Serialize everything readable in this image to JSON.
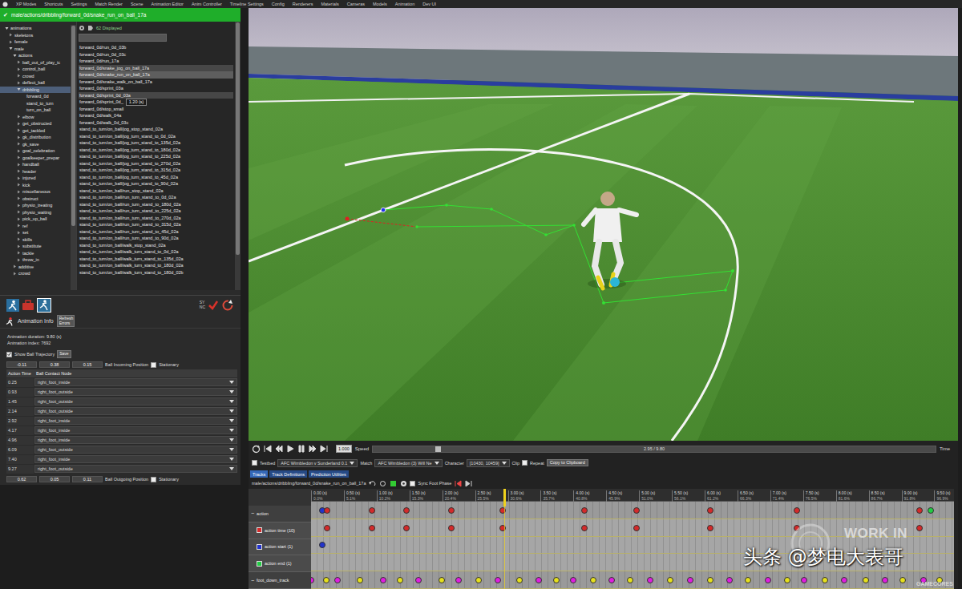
{
  "menu_bar": {
    "items": [
      "XP Modes",
      "Shortcuts",
      "Settings",
      "Match Render",
      "Scene",
      "Animation Editor",
      "Anim Controller",
      "Timeline Settings",
      "Config",
      "Renderers",
      "Materials",
      "Cameras",
      "Models",
      "Animation",
      "Dev UI"
    ]
  },
  "left_panel": {
    "path_bar": {
      "check": "✔",
      "path": "male/actions/dribbling/forward_0d/snake_run_on_ball_17a"
    },
    "tree": [
      {
        "label": "animations",
        "depth": 0,
        "has_children": true,
        "expanded": true,
        "selected": false
      },
      {
        "label": "skeletons",
        "depth": 1,
        "has_children": true,
        "expanded": false,
        "selected": false
      },
      {
        "label": "female",
        "depth": 1,
        "has_children": true,
        "expanded": false,
        "selected": false
      },
      {
        "label": "male",
        "depth": 1,
        "has_children": true,
        "expanded": true,
        "selected": false
      },
      {
        "label": "actions",
        "depth": 2,
        "has_children": true,
        "expanded": true,
        "selected": false
      },
      {
        "label": "ball_out_of_play_ic",
        "depth": 3,
        "has_children": true,
        "expanded": false,
        "selected": false
      },
      {
        "label": "control_ball",
        "depth": 3,
        "has_children": true,
        "expanded": false,
        "selected": false
      },
      {
        "label": "crowd",
        "depth": 3,
        "has_children": true,
        "expanded": false,
        "selected": false
      },
      {
        "label": "deflect_ball",
        "depth": 3,
        "has_children": true,
        "expanded": false,
        "selected": false
      },
      {
        "label": "dribbling",
        "depth": 3,
        "has_children": true,
        "expanded": true,
        "selected": true
      },
      {
        "label": "forward_0d",
        "depth": 4,
        "has_children": false,
        "expanded": false,
        "selected": false
      },
      {
        "label": "stand_to_turn",
        "depth": 4,
        "has_children": false,
        "expanded": false,
        "selected": false
      },
      {
        "label": "turn_on_ball",
        "depth": 4,
        "has_children": false,
        "expanded": false,
        "selected": false
      },
      {
        "label": "elbow",
        "depth": 3,
        "has_children": true,
        "expanded": false,
        "selected": false
      },
      {
        "label": "get_obstructed",
        "depth": 3,
        "has_children": true,
        "expanded": false,
        "selected": false
      },
      {
        "label": "get_tackled",
        "depth": 3,
        "has_children": true,
        "expanded": false,
        "selected": false
      },
      {
        "label": "gk_distribution",
        "depth": 3,
        "has_children": true,
        "expanded": false,
        "selected": false
      },
      {
        "label": "gk_save",
        "depth": 3,
        "has_children": true,
        "expanded": false,
        "selected": false
      },
      {
        "label": "goal_celebration",
        "depth": 3,
        "has_children": true,
        "expanded": false,
        "selected": false
      },
      {
        "label": "goalkeeper_prepar",
        "depth": 3,
        "has_children": true,
        "expanded": false,
        "selected": false
      },
      {
        "label": "handball",
        "depth": 3,
        "has_children": true,
        "expanded": false,
        "selected": false
      },
      {
        "label": "header",
        "depth": 3,
        "has_children": true,
        "expanded": false,
        "selected": false
      },
      {
        "label": "injured",
        "depth": 3,
        "has_children": true,
        "expanded": false,
        "selected": false
      },
      {
        "label": "kick",
        "depth": 3,
        "has_children": true,
        "expanded": false,
        "selected": false
      },
      {
        "label": "miscellaneous",
        "depth": 3,
        "has_children": true,
        "expanded": false,
        "selected": false
      },
      {
        "label": "obstruct",
        "depth": 3,
        "has_children": true,
        "expanded": false,
        "selected": false
      },
      {
        "label": "physio_treating",
        "depth": 3,
        "has_children": true,
        "expanded": false,
        "selected": false
      },
      {
        "label": "physio_waiting",
        "depth": 3,
        "has_children": true,
        "expanded": false,
        "selected": false
      },
      {
        "label": "pick_up_ball",
        "depth": 3,
        "has_children": true,
        "expanded": false,
        "selected": false
      },
      {
        "label": "ref",
        "depth": 3,
        "has_children": true,
        "expanded": false,
        "selected": false
      },
      {
        "label": "set",
        "depth": 3,
        "has_children": true,
        "expanded": false,
        "selected": false
      },
      {
        "label": "skills",
        "depth": 3,
        "has_children": true,
        "expanded": false,
        "selected": false
      },
      {
        "label": "substitute",
        "depth": 3,
        "has_children": true,
        "expanded": false,
        "selected": false
      },
      {
        "label": "tackle",
        "depth": 3,
        "has_children": true,
        "expanded": false,
        "selected": false
      },
      {
        "label": "throw_in",
        "depth": 3,
        "has_children": true,
        "expanded": false,
        "selected": false
      },
      {
        "label": "additive",
        "depth": 2,
        "has_children": true,
        "expanded": false,
        "selected": false
      },
      {
        "label": "crowd",
        "depth": 2,
        "has_children": true,
        "expanded": false,
        "selected": false
      }
    ],
    "files": {
      "count": "62 Displayed",
      "search": "",
      "tooltip": "1.20 (s)",
      "tooltip_row": 8,
      "items": [
        {
          "label": "forward_0d/run_0d_03b",
          "state": "none"
        },
        {
          "label": "forward_0d/run_0d_03c",
          "state": "none"
        },
        {
          "label": "forward_0d/run_17a",
          "state": "none"
        },
        {
          "label": "forward_0d/snake_jog_on_ball_17a",
          "state": "hover"
        },
        {
          "label": "forward_0d/snake_run_on_ball_17a",
          "state": "selected"
        },
        {
          "label": "forward_0d/snake_walk_on_ball_17a",
          "state": "none"
        },
        {
          "label": "forward_0d/sprint_03a",
          "state": "none"
        },
        {
          "label": "forward_0d/sprint_0d_03a",
          "state": "hover"
        },
        {
          "label": "forward_0d/sprint_0d_",
          "state": "none"
        },
        {
          "label": "forward_0d/stop_small",
          "state": "none"
        },
        {
          "label": "forward_0d/walk_04a",
          "state": "none"
        },
        {
          "label": "forward_0d/walk_0d_03c",
          "state": "none"
        },
        {
          "label": "stand_to_turn/on_ball/jog_stop_stand_02a",
          "state": "none"
        },
        {
          "label": "stand_to_turn/on_ball/jog_turn_stand_to_0d_02a",
          "state": "none"
        },
        {
          "label": "stand_to_turn/on_ball/jog_turn_stand_to_135d_02a",
          "state": "none"
        },
        {
          "label": "stand_to_turn/on_ball/jog_turn_stand_to_180d_02a",
          "state": "none"
        },
        {
          "label": "stand_to_turn/on_ball/jog_turn_stand_to_225d_02a",
          "state": "none"
        },
        {
          "label": "stand_to_turn/on_ball/jog_turn_stand_to_270d_02a",
          "state": "none"
        },
        {
          "label": "stand_to_turn/on_ball/jog_turn_stand_to_315d_02a",
          "state": "none"
        },
        {
          "label": "stand_to_turn/on_ball/jog_turn_stand_to_45d_02a",
          "state": "none"
        },
        {
          "label": "stand_to_turn/on_ball/jog_turn_stand_to_90d_02a",
          "state": "none"
        },
        {
          "label": "stand_to_turn/on_ball/run_stop_stand_02a",
          "state": "none"
        },
        {
          "label": "stand_to_turn/on_ball/run_turn_stand_to_0d_02a",
          "state": "none"
        },
        {
          "label": "stand_to_turn/on_ball/run_turn_stand_to_180d_02a",
          "state": "none"
        },
        {
          "label": "stand_to_turn/on_ball/run_turn_stand_to_225d_02a",
          "state": "none"
        },
        {
          "label": "stand_to_turn/on_ball/run_turn_stand_to_270d_02a",
          "state": "none"
        },
        {
          "label": "stand_to_turn/on_ball/run_turn_stand_to_315d_02a",
          "state": "none"
        },
        {
          "label": "stand_to_turn/on_ball/run_turn_stand_to_45d_02a",
          "state": "none"
        },
        {
          "label": "stand_to_turn/on_ball/run_turn_stand_to_90d_02a",
          "state": "none"
        },
        {
          "label": "stand_to_turn/on_ball/walk_stop_stand_02a",
          "state": "none"
        },
        {
          "label": "stand_to_turn/on_ball/walk_turn_stand_to_0d_02a",
          "state": "none"
        },
        {
          "label": "stand_to_turn/on_ball/walk_turn_stand_to_135d_02a",
          "state": "none"
        },
        {
          "label": "stand_to_turn/on_ball/walk_turn_stand_to_180d_02a",
          "state": "none"
        },
        {
          "label": "stand_to_turn/on_ball/walk_turn_stand_to_180d_02b",
          "state": "none"
        }
      ]
    },
    "sync_label": [
      "SY",
      "NC"
    ],
    "animation_info": {
      "title": "Animation Info",
      "refresh_button": "Refresh Errors",
      "duration": "Animation duration: 9.80 (s)",
      "index": "Animation index: 7692",
      "show_ball_trajectory": {
        "label": "Show Ball Trajectory",
        "checked": true
      },
      "save_button": "Save",
      "incoming": {
        "values": [
          "-0.11",
          "0.38",
          "0.15"
        ],
        "label": "Ball Incoming Position",
        "stationary": {
          "label": "Stationary",
          "checked": false
        }
      },
      "contacts": {
        "columns": [
          "Action Time",
          "Ball Contact Node"
        ],
        "rows": [
          {
            "time": "0.25",
            "node": "right_foot_inside"
          },
          {
            "time": "0.93",
            "node": "right_foot_outside"
          },
          {
            "time": "1.45",
            "node": "right_foot_outside"
          },
          {
            "time": "2.14",
            "node": "right_foot_outside"
          },
          {
            "time": "2.92",
            "node": "right_foot_inside"
          },
          {
            "time": "4.17",
            "node": "right_foot_inside"
          },
          {
            "time": "4.96",
            "node": "right_foot_inside"
          },
          {
            "time": "6.09",
            "node": "right_foot_outside"
          },
          {
            "time": "7.40",
            "node": "right_foot_inside"
          },
          {
            "time": "9.27",
            "node": "right_foot_outside"
          }
        ]
      },
      "outgoing": {
        "values": [
          "0.62",
          "0.05",
          "0.11"
        ],
        "label": "Ball Outgoing Position",
        "stationary": {
          "label": "Stationary",
          "checked": false
        }
      }
    }
  },
  "playback": {
    "speed_value": "1.000",
    "speed_label": "Speed",
    "time_readout": "2.95 / 9.80",
    "time_label": "Time",
    "slider": {
      "level": 0.115
    }
  },
  "match_row": {
    "testbed": {
      "label": "Testbed",
      "checked": false
    },
    "match": {
      "value": "AFC Wimbledon v Sunderland 0.1",
      "label": "Match"
    },
    "character": {
      "value": "AFC Wimbledon (3) Will Ne",
      "label": "Character"
    },
    "clip": {
      "value": "[10430, 10459]",
      "label": "Clip"
    },
    "repeat": {
      "label": "Repeat",
      "checked": false
    },
    "copy_button": "Copy to Clipboard"
  },
  "tabs": [
    {
      "label": "Tracks",
      "selected": true
    },
    {
      "label": "Track Definitions",
      "selected": false
    },
    {
      "label": "Prediction Utilities",
      "selected": false
    }
  ],
  "path_row": {
    "path": "male/actions/dribbling/forward_0d/snake_run_on_ball_17a",
    "sync_foot_phase": {
      "label": "Sync Foot Phase",
      "checked": false
    }
  },
  "timeline": {
    "duration": 9.8,
    "playhead": {
      "level": 0.301
    },
    "ruler": [
      {
        "time": "0.00 (s)",
        "pct": "0.0%"
      },
      {
        "time": "0.50 (s)",
        "pct": "5.1%"
      },
      {
        "time": "1.00 (s)",
        "pct": "10.2%"
      },
      {
        "time": "1.50 (s)",
        "pct": "15.3%"
      },
      {
        "time": "2.00 (s)",
        "pct": "20.4%"
      },
      {
        "time": "2.50 (s)",
        "pct": "25.5%"
      },
      {
        "time": "3.00 (s)",
        "pct": "30.6%"
      },
      {
        "time": "3.50 (s)",
        "pct": "35.7%"
      },
      {
        "time": "4.00 (s)",
        "pct": "40.8%"
      },
      {
        "time": "4.50 (s)",
        "pct": "45.9%"
      },
      {
        "time": "5.00 (s)",
        "pct": "51.0%"
      },
      {
        "time": "5.50 (s)",
        "pct": "56.1%"
      },
      {
        "time": "6.00 (s)",
        "pct": "61.2%"
      },
      {
        "time": "6.50 (s)",
        "pct": "66.3%"
      },
      {
        "time": "7.00 (s)",
        "pct": "71.4%"
      },
      {
        "time": "7.50 (s)",
        "pct": "76.5%"
      },
      {
        "time": "8.00 (s)",
        "pct": "81.6%"
      },
      {
        "time": "8.50 (s)",
        "pct": "86.7%"
      },
      {
        "time": "9.00 (s)",
        "pct": "91.8%"
      },
      {
        "time": "9.50 (s)",
        "pct": "96.9%"
      }
    ],
    "tracks": [
      {
        "label": "action",
        "kind": "group",
        "toggle": "−",
        "color": "#9a9a9a",
        "markers": [
          {
            "time": 0.17,
            "color": "#2233cc"
          },
          {
            "time": 0.25,
            "color": "#d42a2a"
          },
          {
            "time": 0.93,
            "color": "#d42a2a"
          },
          {
            "time": 1.45,
            "color": "#d42a2a"
          },
          {
            "time": 2.14,
            "color": "#d42a2a"
          },
          {
            "time": 2.92,
            "color": "#d42a2a"
          },
          {
            "time": 4.17,
            "color": "#d42a2a"
          },
          {
            "time": 4.96,
            "color": "#d42a2a"
          },
          {
            "time": 6.09,
            "color": "#d42a2a"
          },
          {
            "time": 7.4,
            "color": "#d42a2a"
          },
          {
            "time": 9.27,
            "color": "#d42a2a"
          },
          {
            "time": 9.44,
            "color": "#22cc44"
          }
        ]
      },
      {
        "label": "action time (10)",
        "kind": "track",
        "toggle": "",
        "color": "#d42a2a",
        "markers": [
          {
            "time": 0.25,
            "color": "#d42a2a"
          },
          {
            "time": 0.93,
            "color": "#d42a2a"
          },
          {
            "time": 1.45,
            "color": "#d42a2a"
          },
          {
            "time": 2.14,
            "color": "#d42a2a"
          },
          {
            "time": 2.92,
            "color": "#d42a2a"
          },
          {
            "time": 4.17,
            "color": "#d42a2a"
          },
          {
            "time": 4.96,
            "color": "#d42a2a"
          },
          {
            "time": 6.09,
            "color": "#d42a2a"
          },
          {
            "time": 7.4,
            "color": "#d42a2a"
          },
          {
            "time": 9.27,
            "color": "#d42a2a"
          }
        ]
      },
      {
        "label": "action start (1)",
        "kind": "track",
        "toggle": "",
        "color": "#2233cc",
        "markers": [
          {
            "time": 0.17,
            "color": "#2233cc"
          }
        ]
      },
      {
        "label": "action end (1)",
        "kind": "track",
        "toggle": "",
        "color": "#22cc44",
        "markers": []
      },
      {
        "label": "foot_down_track",
        "kind": "group",
        "toggle": "−",
        "color": "#9a9a9a",
        "markers": [
          {
            "time": 0.0,
            "color": "#e01ee0"
          },
          {
            "time": 0.23,
            "color": "#e6e01e"
          },
          {
            "time": 0.4,
            "color": "#e01ee0"
          },
          {
            "time": 0.74,
            "color": "#e6e01e"
          },
          {
            "time": 1.1,
            "color": "#e01ee0"
          },
          {
            "time": 1.36,
            "color": "#e6e01e"
          },
          {
            "time": 1.64,
            "color": "#e01ee0"
          },
          {
            "time": 1.99,
            "color": "#e6e01e"
          },
          {
            "time": 2.25,
            "color": "#e01ee0"
          },
          {
            "time": 2.55,
            "color": "#e6e01e"
          },
          {
            "time": 2.85,
            "color": "#e01ee0"
          },
          {
            "time": 3.18,
            "color": "#e6e01e"
          },
          {
            "time": 3.47,
            "color": "#e01ee0"
          },
          {
            "time": 3.74,
            "color": "#e6e01e"
          },
          {
            "time": 4.0,
            "color": "#e01ee0"
          },
          {
            "time": 4.3,
            "color": "#e6e01e"
          },
          {
            "time": 4.58,
            "color": "#e01ee0"
          },
          {
            "time": 4.86,
            "color": "#e6e01e"
          },
          {
            "time": 5.17,
            "color": "#e01ee0"
          },
          {
            "time": 5.47,
            "color": "#e6e01e"
          },
          {
            "time": 5.78,
            "color": "#e01ee0"
          },
          {
            "time": 6.08,
            "color": "#e6e01e"
          },
          {
            "time": 6.38,
            "color": "#e01ee0"
          },
          {
            "time": 6.66,
            "color": "#e6e01e"
          },
          {
            "time": 6.96,
            "color": "#e01ee0"
          },
          {
            "time": 7.26,
            "color": "#e6e01e"
          },
          {
            "time": 7.52,
            "color": "#e01ee0"
          },
          {
            "time": 7.83,
            "color": "#e6e01e"
          },
          {
            "time": 8.12,
            "color": "#e01ee0"
          },
          {
            "time": 8.45,
            "color": "#e6e01e"
          },
          {
            "time": 8.75,
            "color": "#e01ee0"
          },
          {
            "time": 9.02,
            "color": "#e6e01e"
          },
          {
            "time": 9.33,
            "color": "#e01ee0"
          },
          {
            "time": 9.58,
            "color": "#e6e01e"
          }
        ]
      }
    ]
  },
  "watermark": {
    "work_in": "WORK IN",
    "site": "头条 @梦电大表哥",
    "brand": "GAMECORES"
  }
}
